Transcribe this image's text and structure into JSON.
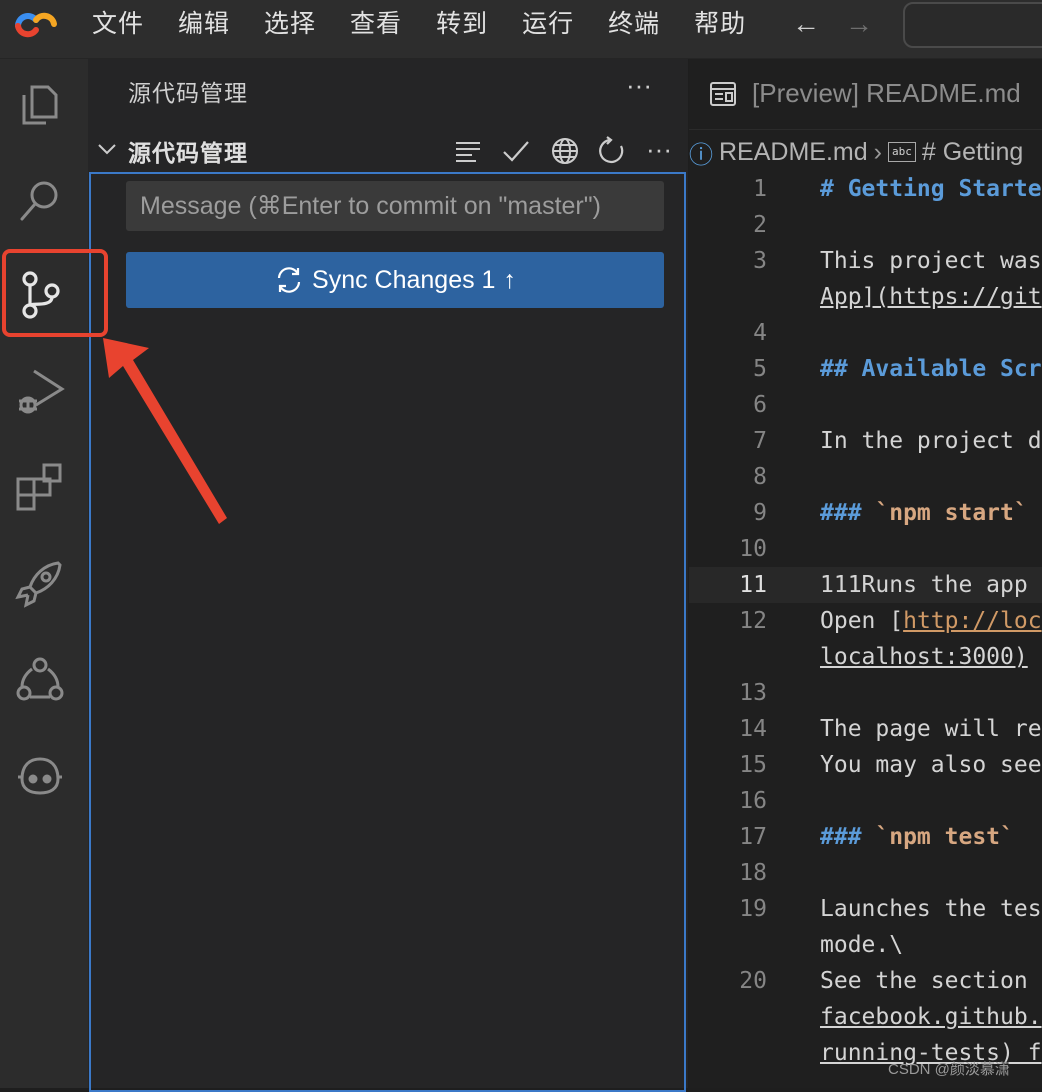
{
  "menu": {
    "items": [
      "文件",
      "编辑",
      "选择",
      "查看",
      "转到",
      "运行",
      "终端",
      "帮助"
    ],
    "back": "←",
    "forward": "→"
  },
  "activity_bar": {
    "icons": [
      "explorer-icon",
      "search-icon",
      "source-control-icon",
      "run-debug-icon",
      "extensions-icon",
      "rocket-icon",
      "share-icon",
      "copilot-icon"
    ]
  },
  "sidebar": {
    "title": "源代码管理",
    "more": "···",
    "section_title": "源代码管理",
    "commit_placeholder": "Message (⌘Enter to commit on \"master\")",
    "sync_label": "Sync Changes 1",
    "sync_arrow": "↑"
  },
  "editor": {
    "tab_label": "[Preview] README.md",
    "breadcrumb": {
      "file": "README.md",
      "symbol": "# Getting",
      "abc": "abc"
    },
    "lines": [
      {
        "n": "1",
        "t": "# Getting Starte",
        "cls": "heading"
      },
      {
        "n": "2",
        "t": "",
        "cls": ""
      },
      {
        "n": "3",
        "t": "This project was",
        "cls": ""
      },
      {
        "n": "",
        "t": "App](https://git",
        "cls": "link"
      },
      {
        "n": "4",
        "t": "",
        "cls": ""
      },
      {
        "n": "5",
        "t": "## Available Scr",
        "cls": "heading"
      },
      {
        "n": "6",
        "t": "",
        "cls": ""
      },
      {
        "n": "7",
        "t": "In the project d",
        "cls": ""
      },
      {
        "n": "8",
        "t": "",
        "cls": ""
      },
      {
        "n": "9",
        "t": "### `npm start`",
        "cls": "h3code"
      },
      {
        "n": "10",
        "t": "",
        "cls": ""
      },
      {
        "n": "11",
        "t": "111Runs the app",
        "cls": "current"
      },
      {
        "n": "12",
        "t": "Open [http://loc",
        "cls": "openlink"
      },
      {
        "n": "",
        "t": "localhost:3000)",
        "cls": "link"
      },
      {
        "n": "13",
        "t": "",
        "cls": ""
      },
      {
        "n": "14",
        "t": "The page will re",
        "cls": ""
      },
      {
        "n": "15",
        "t": "You may also see",
        "cls": ""
      },
      {
        "n": "16",
        "t": "",
        "cls": ""
      },
      {
        "n": "17",
        "t": "### `npm test`",
        "cls": "h3code"
      },
      {
        "n": "18",
        "t": "",
        "cls": ""
      },
      {
        "n": "19",
        "t": "Launches the tes",
        "cls": ""
      },
      {
        "n": "",
        "t": "mode.\\",
        "cls": ""
      },
      {
        "n": "20",
        "t": "See the section",
        "cls": ""
      },
      {
        "n": "",
        "t": "facebook.github.",
        "cls": "link"
      },
      {
        "n": "",
        "t": "running-tests) f",
        "cls": "link"
      }
    ]
  },
  "watermark": "CSDN @颜淡慕潇",
  "colors": {
    "accent": "#2d63a0",
    "focus_border": "#3b79c8",
    "annotation": "#e8432f",
    "heading": "#5b9bd9",
    "inline_code": "#d7a781"
  }
}
